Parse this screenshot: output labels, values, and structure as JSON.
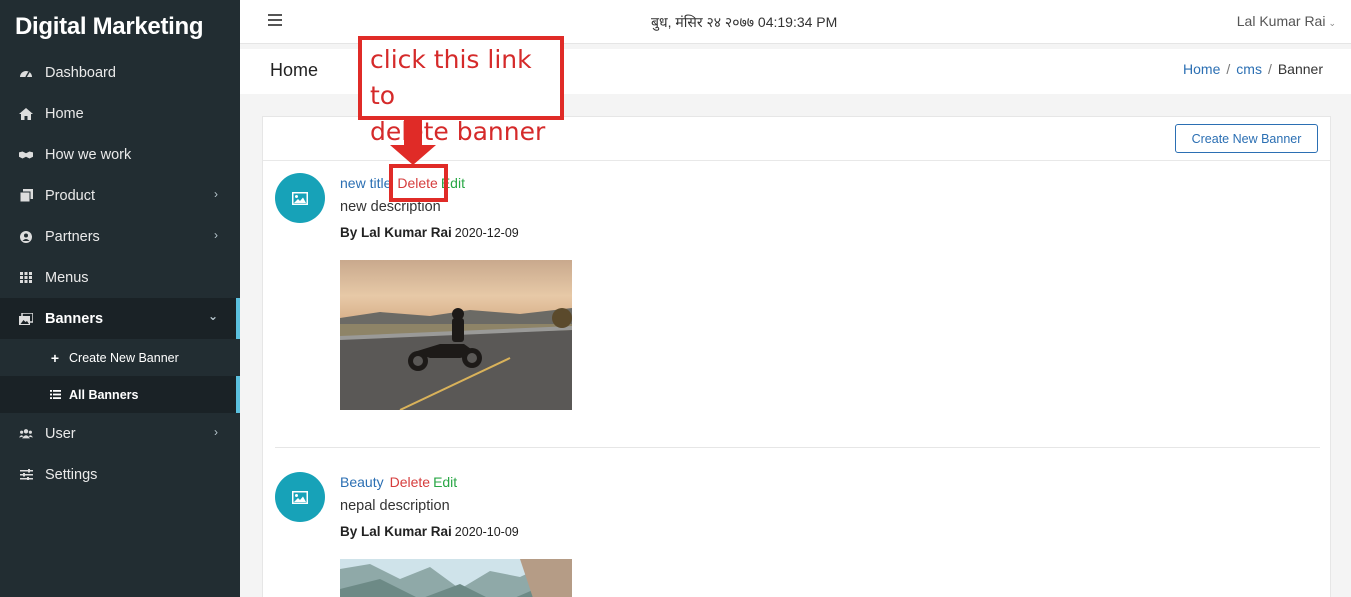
{
  "sidebar": {
    "brand": "Digital Marketing",
    "items": [
      {
        "label": "Dashboard",
        "icon": "dashboard-icon"
      },
      {
        "label": "Home",
        "icon": "home-icon"
      },
      {
        "label": "How we work",
        "icon": "handshake-icon"
      },
      {
        "label": "Product",
        "icon": "box-icon"
      },
      {
        "label": "Partners",
        "icon": "user-circle-icon"
      },
      {
        "label": "Menus",
        "icon": "grid-icon"
      },
      {
        "label": "Banners",
        "icon": "images-icon"
      },
      {
        "label": "User",
        "icon": "users-icon"
      },
      {
        "label": "Settings",
        "icon": "sliders-icon"
      }
    ],
    "subitems": [
      {
        "label": "Create New Banner",
        "icon": "plus-icon"
      },
      {
        "label": "All Banners",
        "icon": "list-icon"
      }
    ]
  },
  "topbar": {
    "datetime": "बुध, मंसिर २४ २०७७ 04:19:34 PM",
    "user": "Lal Kumar Rai"
  },
  "header": {
    "title": "Home",
    "breadcrumb": [
      "Home",
      "cms",
      "Banner"
    ]
  },
  "card": {
    "create_button": "Create New Banner"
  },
  "posts": [
    {
      "title": "new title",
      "delete": "Delete",
      "edit": "Edit",
      "description": "new description",
      "author": "By Lal Kumar Rai",
      "date": "2020-12-09"
    },
    {
      "title": "Beauty",
      "delete": "Delete",
      "edit": "Edit",
      "description": "nepal description",
      "author": "By Lal Kumar Rai",
      "date": "2020-10-09"
    }
  ],
  "annotation": {
    "line1": "click this link to",
    "line2": "delete banner"
  },
  "colors": {
    "sidebar": "#222d32",
    "accent": "#5bc0de",
    "link": "#2b6fb3",
    "delete": "#d63d3d",
    "edit": "#28a745",
    "annotation": "#e02b27"
  }
}
